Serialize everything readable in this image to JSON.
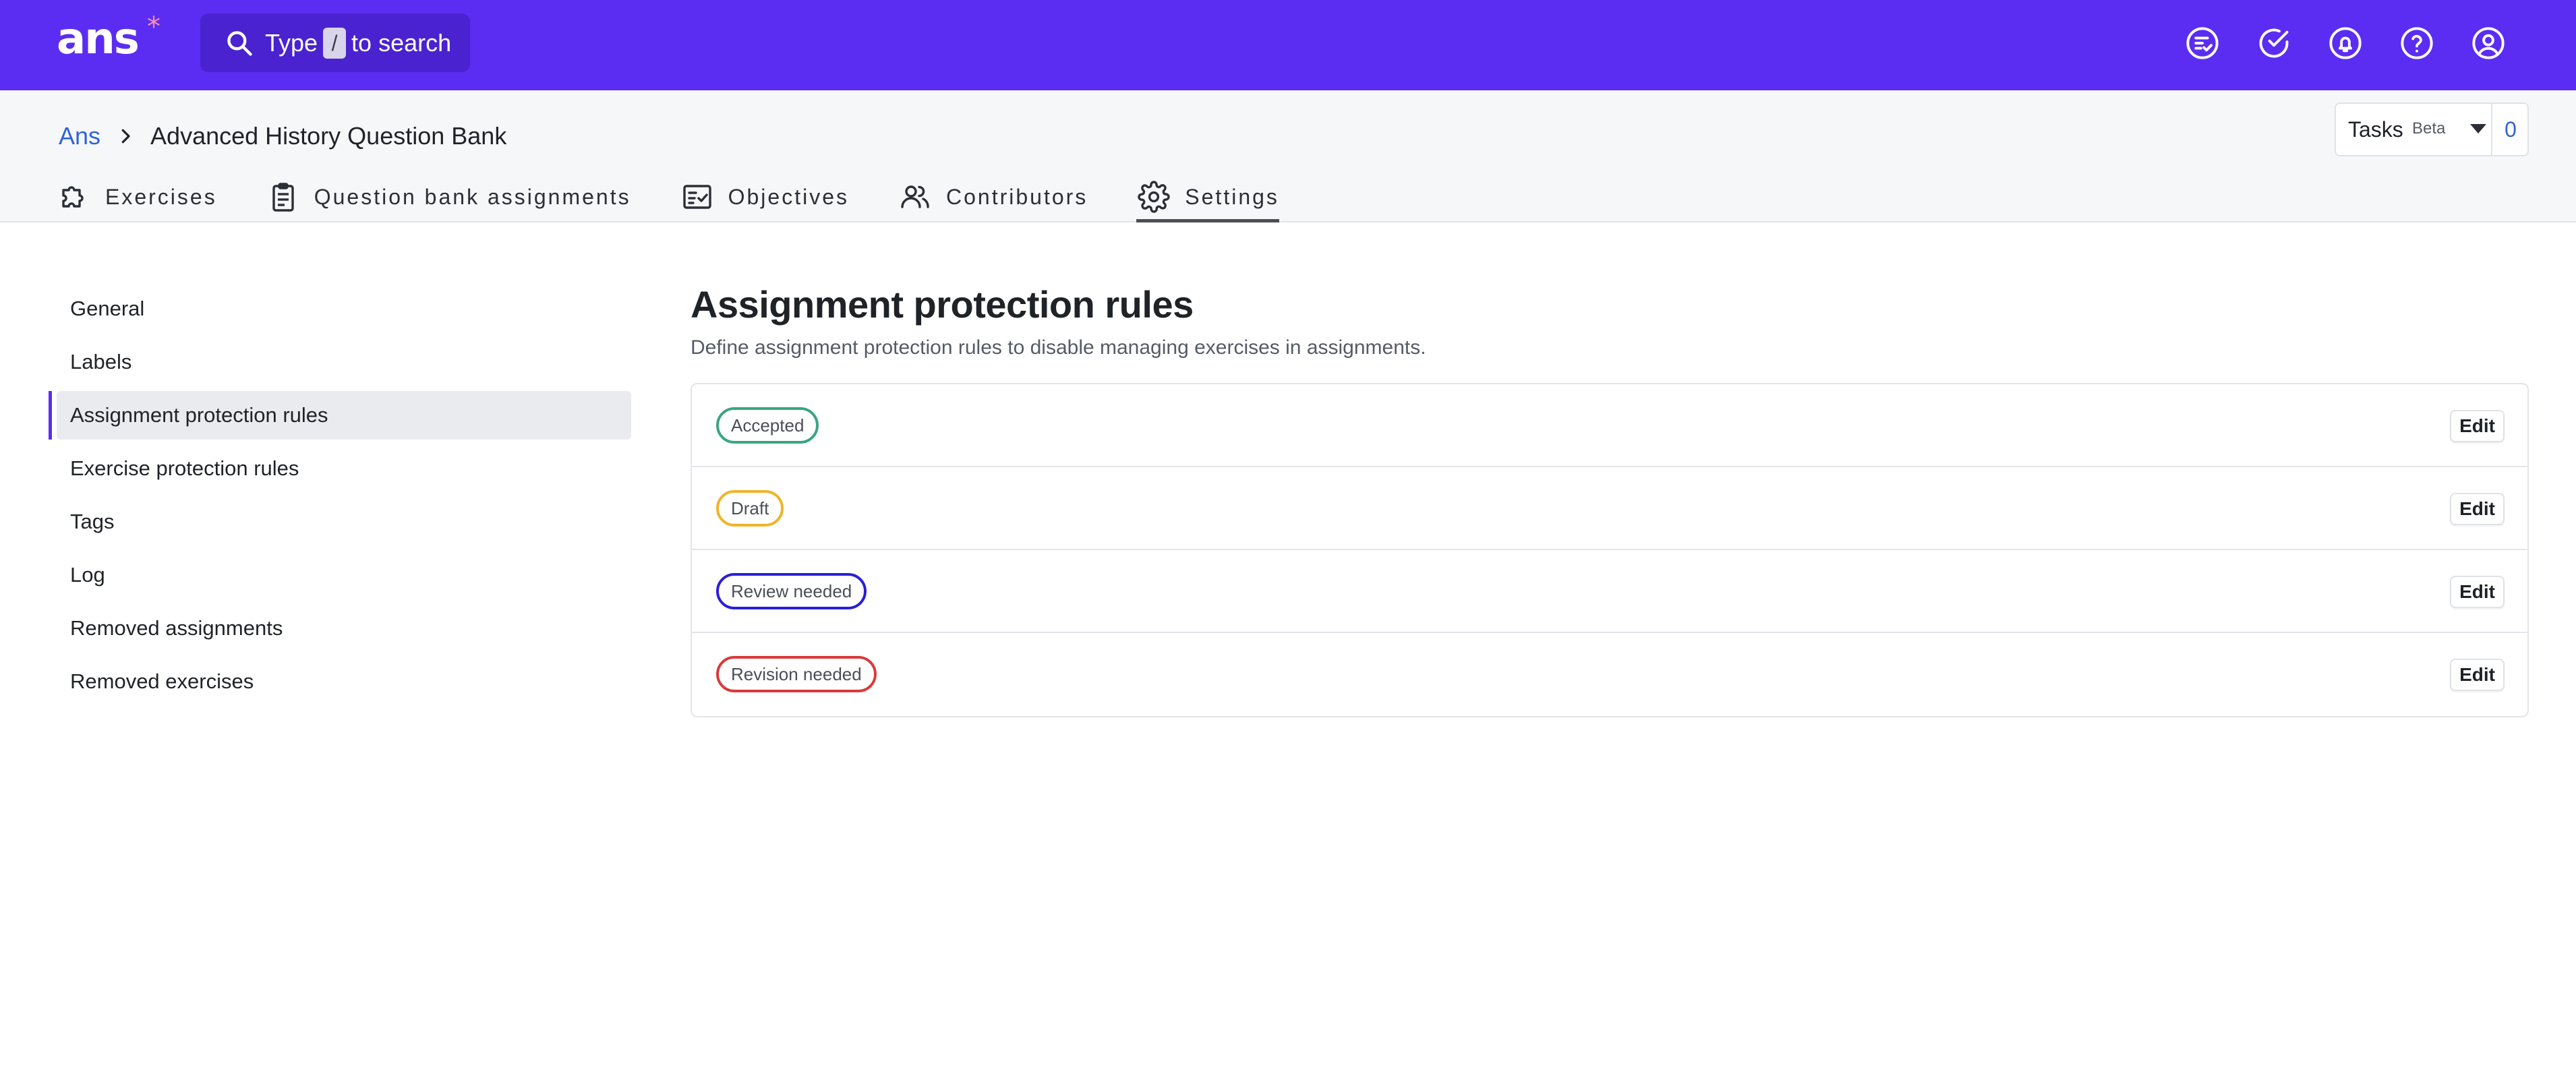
{
  "app": {
    "logo_text": "ans",
    "logo_mark": "*",
    "search": {
      "prefix": "Type",
      "key": "/",
      "suffix": "to search",
      "icon": "search-icon"
    },
    "top_icons": [
      "task-list-icon",
      "check-circle-icon",
      "bell-icon",
      "help-icon",
      "account-icon"
    ]
  },
  "breadcrumb": {
    "root": "Ans",
    "current": "Advanced History Question Bank"
  },
  "tasks": {
    "label": "Tasks",
    "badge": "Beta",
    "count": "0"
  },
  "tabs": [
    {
      "label": "Exercises",
      "icon": "puzzle-icon"
    },
    {
      "label": "Question bank assignments",
      "icon": "clipboard-icon"
    },
    {
      "label": "Objectives",
      "icon": "checklist-icon"
    },
    {
      "label": "Contributors",
      "icon": "users-icon"
    },
    {
      "label": "Settings",
      "icon": "gear-icon",
      "active": true
    }
  ],
  "sidebar": {
    "items": [
      {
        "label": "General"
      },
      {
        "label": "Labels"
      },
      {
        "label": "Assignment protection rules",
        "active": true
      },
      {
        "label": "Exercise protection rules"
      },
      {
        "label": "Tags"
      },
      {
        "label": "Log"
      },
      {
        "label": "Removed assignments"
      },
      {
        "label": "Removed exercises"
      }
    ]
  },
  "main": {
    "title": "Assignment protection rules",
    "description": "Define assignment protection rules to disable managing exercises in assignments.",
    "rules": [
      {
        "status": "Accepted",
        "color": "#3aa584",
        "action": "Edit"
      },
      {
        "status": "Draft",
        "color": "#f0b429",
        "action": "Edit"
      },
      {
        "status": "Review needed",
        "color": "#2a1fd6",
        "action": "Edit"
      },
      {
        "status": "Revision needed",
        "color": "#d93a3a",
        "action": "Edit"
      }
    ]
  },
  "colors": {
    "brand": "#5b2df2",
    "link": "#2f64d6"
  }
}
